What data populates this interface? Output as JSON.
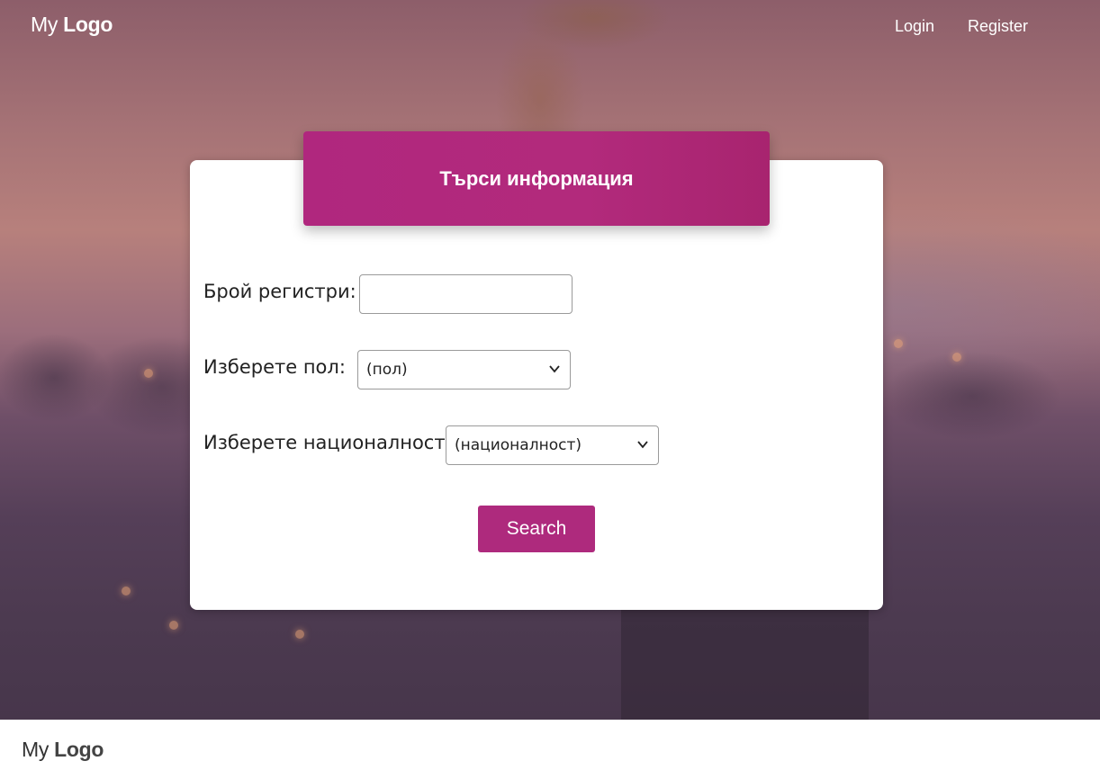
{
  "navbar": {
    "brand_prefix": "My",
    "brand_name": "Logo",
    "links": [
      {
        "label": "Login"
      },
      {
        "label": "Register"
      }
    ]
  },
  "form": {
    "title": "Търси информация",
    "count_label": "Брой регистри:",
    "count_value": "",
    "gender_label": "Изберете пол:",
    "gender_selected": "(пол)",
    "nationality_label": "Изберете националност:",
    "nationality_selected": "(националност)",
    "submit_label": "Search"
  },
  "footer": {
    "brand_prefix": "My",
    "brand_name": "Logo"
  },
  "colors": {
    "accent": "#ae2a7d",
    "header_bg": "#b0277e",
    "card_bg": "#ffffff"
  },
  "icons": {
    "select_arrow": "chevron-down-icon"
  }
}
